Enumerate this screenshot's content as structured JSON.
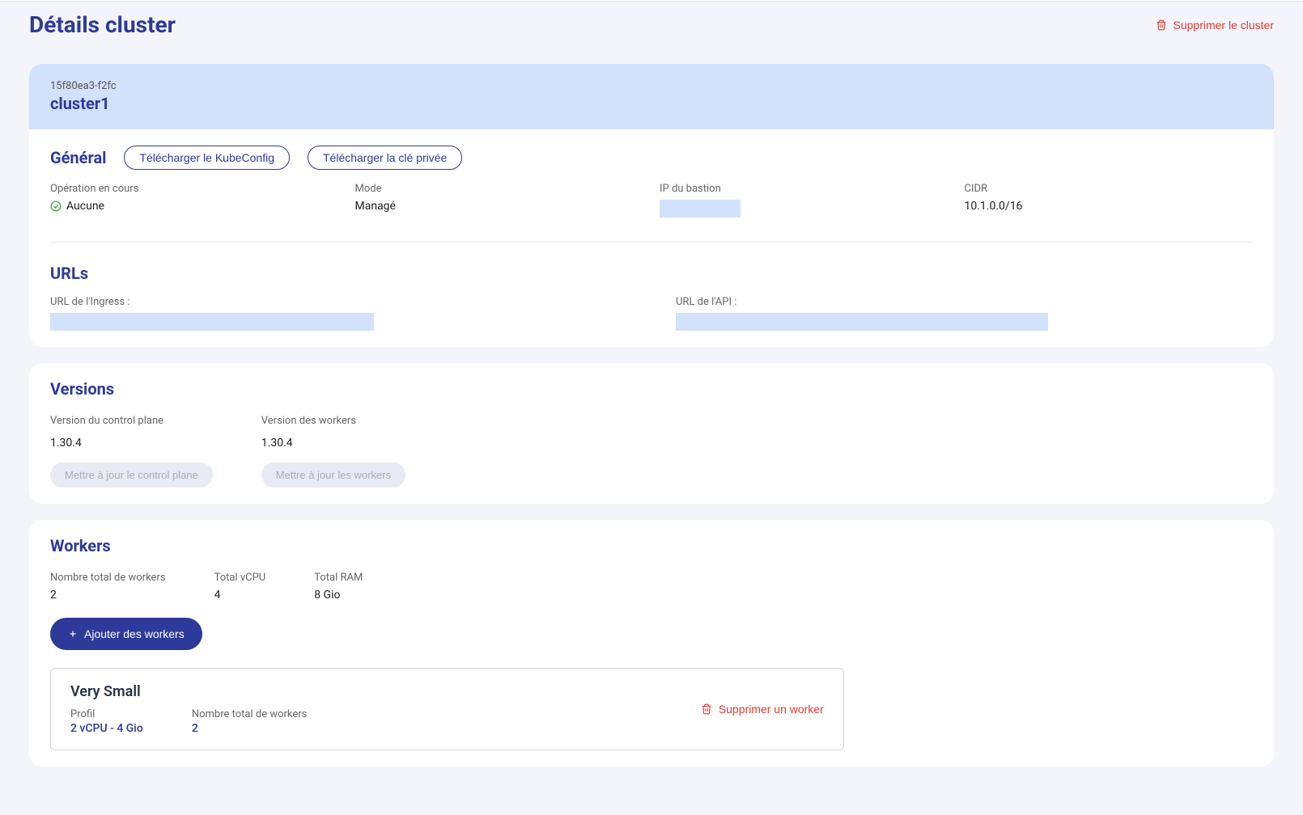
{
  "pageTitle": "Détails cluster",
  "deleteClusterLabel": "Supprimer le cluster",
  "cluster": {
    "id": "15f80ea3-f2fc",
    "name": "cluster1"
  },
  "general": {
    "title": "Général",
    "downloadKubeConfig": "Télécharger le KubeConfig",
    "downloadPrivateKey": "Télécharger la clé privée",
    "operationLabel": "Opération en cours",
    "operationValue": "Aucune",
    "modeLabel": "Mode",
    "modeValue": "Managé",
    "bastionIpLabel": "IP du bastion",
    "cidrLabel": "CIDR",
    "cidrValue": "10.1.0.0/16"
  },
  "urls": {
    "title": "URLs",
    "ingressLabel": "URL de l'Ingress :",
    "apiLabel": "URL de l'API :"
  },
  "versions": {
    "title": "Versions",
    "controlPlaneLabel": "Version du control plane",
    "controlPlaneValue": "1.30.4",
    "workersLabel": "Version des workers",
    "workersValue": "1.30.4",
    "updateControlPlane": "Mettre à jour le control plane",
    "updateWorkers": "Mettre à jour les workers"
  },
  "workers": {
    "title": "Workers",
    "totalWorkersLabel": "Nombre total de workers",
    "totalWorkersValue": "2",
    "totalVcpuLabel": "Total vCPU",
    "totalVcpuValue": "4",
    "totalRamLabel": "Total RAM",
    "totalRamValue": "8 Gio",
    "addWorkersLabel": "Ajouter des workers",
    "workerType": {
      "name": "Very Small",
      "profileLabel": "Profil",
      "profileValue": "2 vCPU - 4 Gio",
      "countLabel": "Nombre total de workers",
      "countValue": "2",
      "deleteLabel": "Supprimer un worker"
    }
  }
}
